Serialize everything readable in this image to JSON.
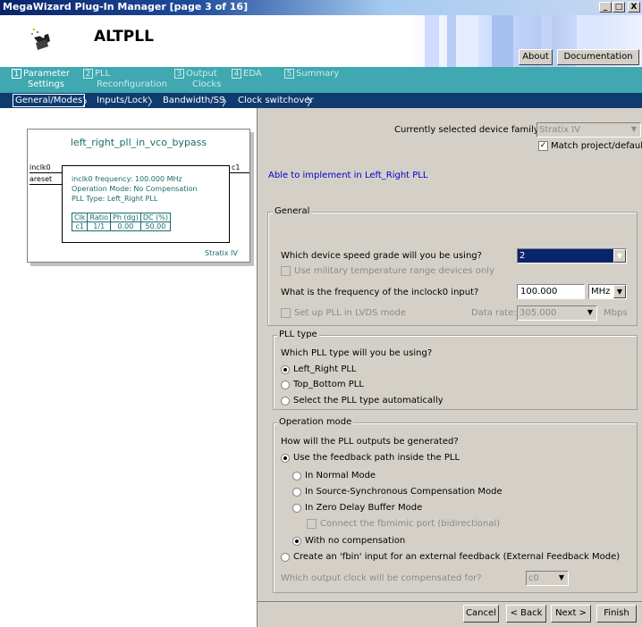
{
  "window": {
    "title": "MegaWizard Plug-In Manager [page 3 of 16]",
    "controls": [
      "_",
      "□",
      "X"
    ]
  },
  "header": {
    "title": "ALTPLL",
    "about_label": "About",
    "documentation_label": "Documentation"
  },
  "steps": [
    {
      "num": "1",
      "label1": "Parameter",
      "label2": "Settings"
    },
    {
      "num": "2",
      "label1": "PLL",
      "label2": "Reconfiguration"
    },
    {
      "num": "3",
      "label1": "Output",
      "label2": "Clocks"
    },
    {
      "num": "4",
      "label1": "EDA",
      "label2": ""
    },
    {
      "num": "5",
      "label1": "Summary",
      "label2": ""
    }
  ],
  "substeps": [
    "General/Modes",
    "Inputs/Lock",
    "Bandwidth/SS",
    "Clock switchover"
  ],
  "diagram": {
    "name": "left_right_pll_in_vco_bypass",
    "port_inclk": "inclk0",
    "port_areset": "areset",
    "port_c1": "c1",
    "info_freq": "inclk0 frequency: 100.000 MHz",
    "info_mode": "Operation Mode: No Compensation",
    "info_type": "PLL Type: Left_Right PLL",
    "table_headers": [
      "Clk",
      "Ratio",
      "Ph (dg)",
      "DC (%)"
    ],
    "table_row": [
      "c1",
      "1/1",
      "0.00",
      "50.00"
    ],
    "family": "Stratix IV"
  },
  "device": {
    "label": "Currently selected device family:",
    "value": "Stratix IV",
    "match_label": "Match project/default",
    "status": "Able to implement in Left_Right PLL"
  },
  "general": {
    "group_label": "General",
    "speed_question": "Which device speed grade will you be using?",
    "speed_value": "2",
    "military_label": "Use military temperature range devices only",
    "freq_question": "What is the frequency of the inclock0 input?",
    "freq_value": "100.000",
    "freq_unit": "MHz",
    "lvds_label": "Set up PLL in LVDS mode",
    "data_rate_label": "Data rate:",
    "data_rate_value": "305.000",
    "data_rate_unit": "Mbps"
  },
  "pll_type": {
    "group_label": "PLL type",
    "question": "Which PLL type will you be using?",
    "options": [
      "Left_Right PLL",
      "Top_Bottom PLL",
      "Select the PLL type automatically"
    ]
  },
  "operation": {
    "group_label": "Operation mode",
    "question": "How will the PLL outputs be generated?",
    "feedback_label": "Use the feedback path inside the PLL",
    "normal": "In Normal Mode",
    "source_sync": "In Source-Synchronous Compensation Mode",
    "zero_delay": "In Zero Delay Buffer Mode",
    "fbmimic": "Connect the fbmimic port (bidirectional)",
    "no_comp": "With no compensation",
    "external": "Create an 'fbin' input for an external feedback (External Feedback Mode)",
    "compensated_question": "Which output clock will be compensated for?",
    "compensated_value": "c0"
  },
  "footer": {
    "cancel": "Cancel",
    "back": "< Back",
    "next": "Next >",
    "finish": "Finish"
  }
}
